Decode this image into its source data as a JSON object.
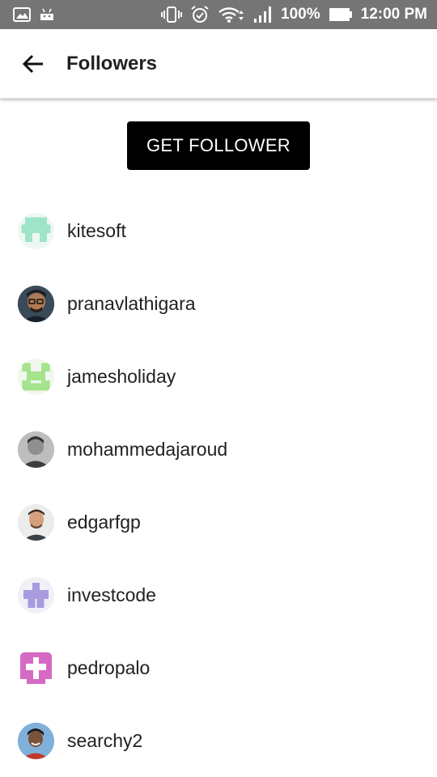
{
  "status_bar": {
    "battery_text": "100%",
    "time": "12:00 PM",
    "left_icons": [
      "gallery-icon",
      "android-icon"
    ],
    "right_icons": [
      "vibrate-icon",
      "alarm-icon",
      "wifi-icon",
      "signal-icon",
      "battery-icon"
    ]
  },
  "app_bar": {
    "title": "Followers",
    "back_icon": "arrow-left-icon"
  },
  "cta": {
    "label": "GET FOLLOWER"
  },
  "followers": [
    {
      "username": "kitesoft",
      "avatar": "identicon-mint"
    },
    {
      "username": "pranavlathigara",
      "avatar": "photo-glasses"
    },
    {
      "username": "jamesholiday",
      "avatar": "identicon-green"
    },
    {
      "username": "mohammedajaroud",
      "avatar": "photo-bw"
    },
    {
      "username": "edgarfgp",
      "avatar": "photo-man"
    },
    {
      "username": "investcode",
      "avatar": "identicon-lavender"
    },
    {
      "username": "pedropalo",
      "avatar": "identicon-magenta"
    },
    {
      "username": "searchy2",
      "avatar": "photo-boy"
    }
  ],
  "colors": {
    "status_bar_bg": "#757575",
    "cta_bg": "#000000",
    "identicon_mint": "#9ee4c8",
    "identicon_green": "#a6e38d",
    "identicon_lavender": "#a99be0",
    "identicon_magenta": "#d569c4"
  }
}
